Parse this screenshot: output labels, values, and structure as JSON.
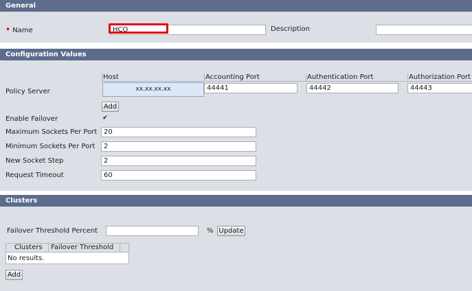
{
  "general": {
    "header": "General",
    "name_label": "Name",
    "required_marker": "•",
    "name_value": "HCO",
    "description_label": "Description",
    "description_value": ""
  },
  "config": {
    "header": "Configuration Values",
    "policy_server_label": "Policy Server",
    "columns": {
      "host": "Host",
      "accounting_port": "Accounting Port",
      "authentication_port": "Authentication Port",
      "authorization_port": "Authorization Port"
    },
    "row": {
      "host": "xx.xx.xx.xx",
      "accounting_port": "44441",
      "authentication_port": "44442",
      "authorization_port": "44443"
    },
    "add_label": "Add",
    "enable_failover_label": "Enable Failover",
    "enable_failover_checked": true,
    "check_glyph": "✔",
    "max_sockets_label": "Maximum Sockets Per Port",
    "max_sockets_value": "20",
    "min_sockets_label": "Minimum Sockets Per Port",
    "min_sockets_value": "2",
    "new_socket_step_label": "New Socket Step",
    "new_socket_step_value": "2",
    "request_timeout_label": "Request Timeout",
    "request_timeout_value": "60"
  },
  "clusters": {
    "header": "Clusters",
    "failover_threshold_label": "Failover Threshold Percent",
    "failover_threshold_value": "",
    "percent_sign": "%",
    "update_label": "Update",
    "table_columns": [
      "Clusters",
      "Failover Threshold"
    ],
    "empty_text": "No results.",
    "add_label": "Add"
  },
  "colors": {
    "header_bg": "#5d6c8c",
    "panel_bg": "#dcdfe6",
    "highlight_border": "#e0000f",
    "host_selected_bg": "#dce8f7"
  }
}
